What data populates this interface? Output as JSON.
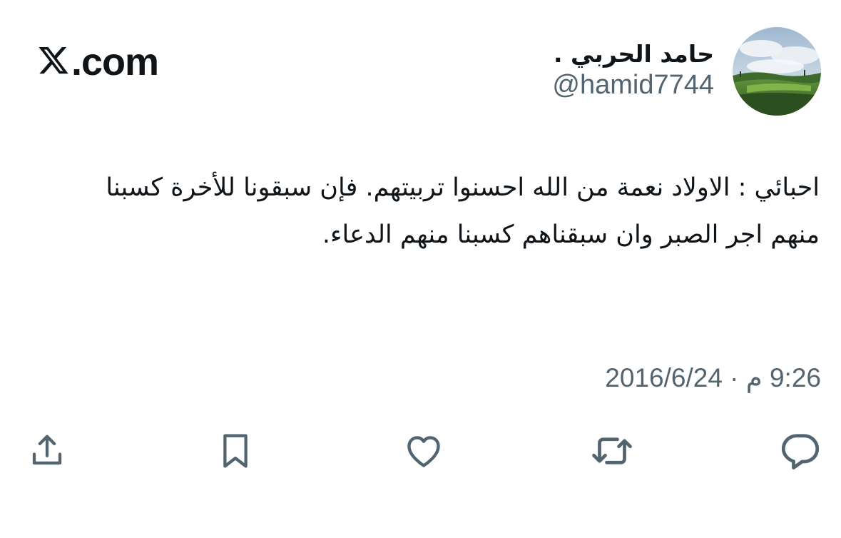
{
  "brand": {
    "text": ".com",
    "logo_icon": "x-logo-icon"
  },
  "author": {
    "name": "حامد الحربي .",
    "handle": "@hamid7744",
    "avatar": "landscape-photo-avatar"
  },
  "tweet": {
    "text": "احبائي : الاولاد نعمة من الله احسنوا تربيتهم. فإن سبقونا للأخرة كسبنا منهم اجر الصبر وان سبقناهم كسبنا منهم الدعاء.",
    "timestamp": "9:26 م · 2016/6/24"
  },
  "actions": [
    {
      "name": "reply",
      "icon": "reply-icon"
    },
    {
      "name": "retweet",
      "icon": "retweet-icon"
    },
    {
      "name": "like",
      "icon": "heart-icon"
    },
    {
      "name": "bookmark",
      "icon": "bookmark-icon"
    },
    {
      "name": "share",
      "icon": "share-icon"
    }
  ],
  "colors": {
    "text": "#0f1419",
    "secondary": "#536471",
    "icon": "#536471",
    "background": "#ffffff"
  }
}
